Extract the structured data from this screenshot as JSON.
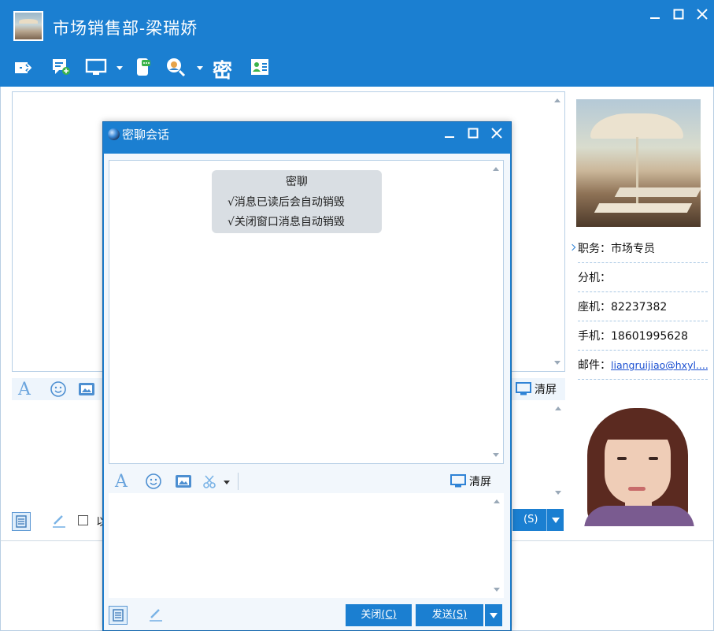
{
  "main_window": {
    "title": "市场销售部-梁瑞娇",
    "toolbar_secret_label": "密",
    "clear_label": "清屏",
    "send_label_tail": "(S)",
    "checkbox_label": "以"
  },
  "contact": {
    "rows": [
      {
        "key": "职务：",
        "value": "市场专员"
      },
      {
        "key": "分机：",
        "value": ""
      },
      {
        "key": "座机：",
        "value": "82237382"
      },
      {
        "key": "手机：",
        "value": "18601995628"
      },
      {
        "key": "邮件：",
        "value": "liangruijiao@hxyl...."
      }
    ]
  },
  "dialog": {
    "title": "密聊会话",
    "notice": {
      "title": "密聊",
      "lines": [
        "√消息已读后会自动销毁",
        "√关闭窗口消息自动销毁"
      ]
    },
    "clear_label": "清屏",
    "close_label": "关闭",
    "close_hotkey": "(C)",
    "send_label": "发送",
    "send_hotkey": "(S)"
  },
  "colors": {
    "accent": "#1b7fd1",
    "panel_bg": "#f2f7fc",
    "notice_bg": "#d9dee3"
  }
}
